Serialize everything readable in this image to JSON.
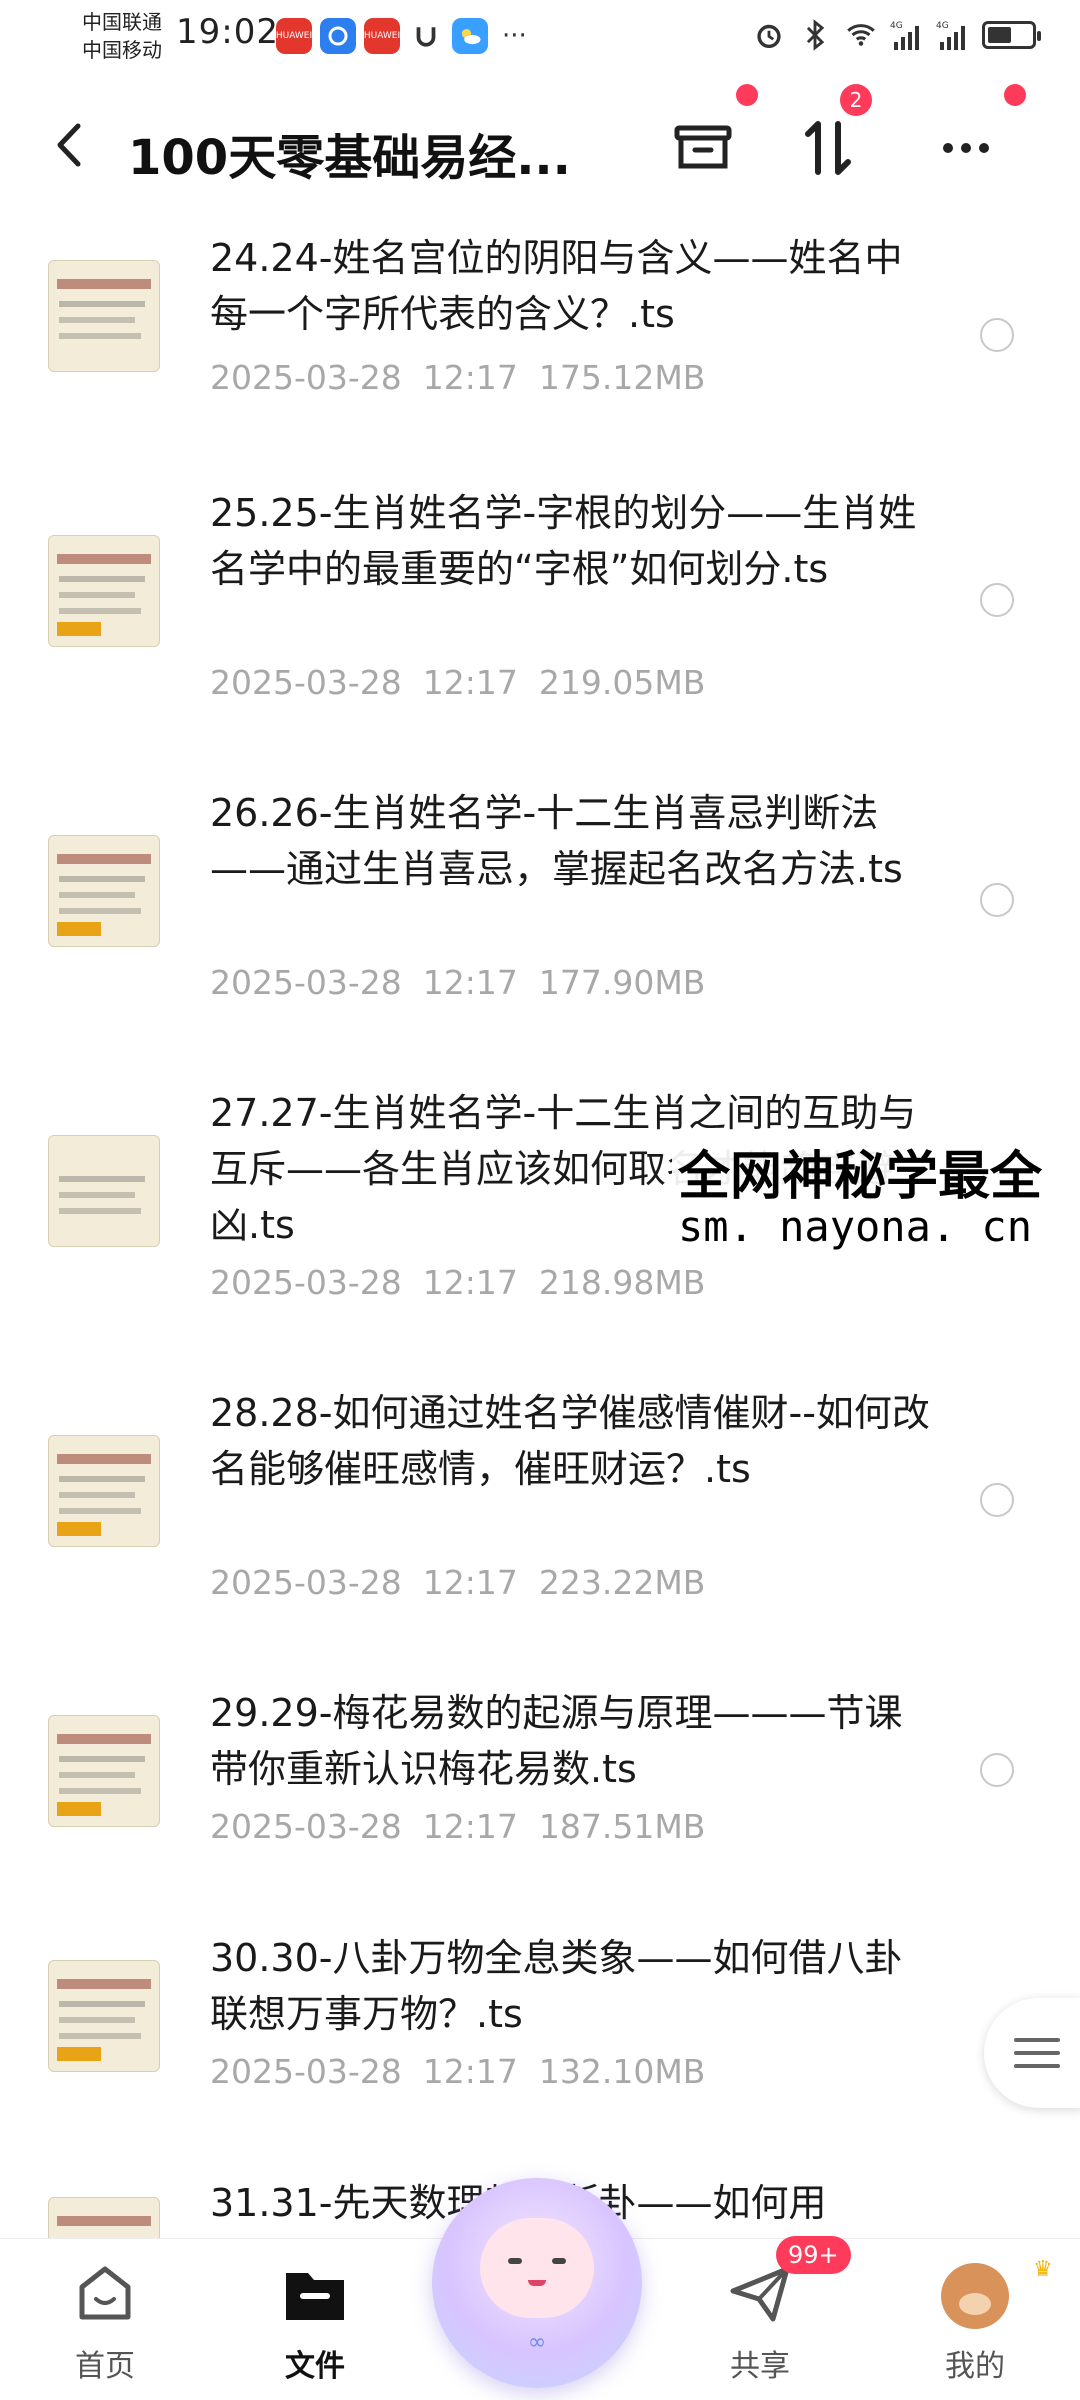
{
  "status_bar": {
    "carrier1": "中国联通",
    "carrier2": "中国移动",
    "time": "19:02",
    "app_badges": [
      {
        "name": "huawei-app-icon",
        "text": "HUAWEI",
        "color": "#e3362c"
      },
      {
        "name": "browser-app-icon",
        "text": "",
        "color": "#2d7ff0"
      },
      {
        "name": "huawei-app-icon-2",
        "text": "HUAWEI",
        "color": "#e3362c"
      },
      {
        "name": "u-app-icon",
        "text": "",
        "color": "transparent"
      },
      {
        "name": "weather-app-icon",
        "text": "",
        "color": "#3aa0ff"
      }
    ],
    "more": "···",
    "signal1_label": "4G",
    "signal2_label": "4G",
    "battery_level": 0.55
  },
  "header": {
    "title": "100天零基础易经..."
  },
  "badges": {
    "sort_count": "2",
    "share_count": "99+"
  },
  "files": [
    {
      "name": "24.24-姓名宫位的阴阳与含义——姓名中每一个字所代表的含义？.ts",
      "date": "2025-03-28",
      "time": "12:17",
      "size": "175.12MB"
    },
    {
      "name": "25.25-生肖姓名学-字根的划分——生肖姓名学中的最重要的“字根”如何划分.ts",
      "date": "2025-03-28",
      "time": "12:17",
      "size": "219.05MB"
    },
    {
      "name": "26.26-生肖姓名学-十二生肖喜忌判断法——通过生肖喜忌，掌握起名改名方法.ts",
      "date": "2025-03-28",
      "time": "12:17",
      "size": "177.90MB"
    },
    {
      "name": "27.27-生肖姓名学-十二生肖之间的互助与互斥——各生肖应该如何取名才能趋吉避凶.ts",
      "date": "2025-03-28",
      "time": "12:17",
      "size": "218.98MB"
    },
    {
      "name": "28.28-如何通过姓名学催感情催财--如何改名能够催旺感情，催旺财运？.ts",
      "date": "2025-03-28",
      "time": "12:17",
      "size": "223.22MB"
    },
    {
      "name": "29.29-梅花易数的起源与原理———节课带你重新认识梅花易数.ts",
      "date": "2025-03-28",
      "time": "12:17",
      "size": "187.51MB"
    },
    {
      "name": "30.30-八卦万物全息类象——如何借八卦联想万事万物？.ts",
      "date": "2025-03-28",
      "time": "12:17",
      "size": "132.10MB"
    },
    {
      "name": "31.31-先天数理起卦断卦——如何用",
      "date": "",
      "time": "",
      "size": ""
    }
  ],
  "watermark": {
    "line1": "全网神秘学最全",
    "line2": "sm. nayona. cn"
  },
  "nav": {
    "home": "首页",
    "files": "文件",
    "share": "共享",
    "mine": "我的"
  }
}
